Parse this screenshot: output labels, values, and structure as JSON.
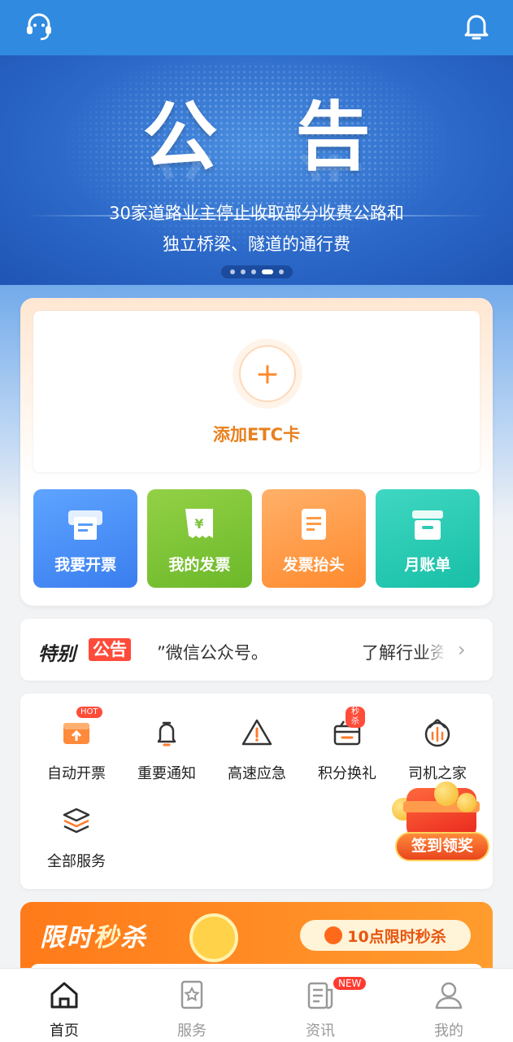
{
  "colors": {
    "brand_blue": "#2f8ae0",
    "accent_orange": "#ff8a2e",
    "tab_active": "#222222"
  },
  "topbar": {
    "left_icon": "headset-icon",
    "right_icon": "bell-icon"
  },
  "banner": {
    "title": "公告",
    "line1": "30家道路业主停止收取部分收费公路和",
    "line2": "独立桥梁、隧道的通行费",
    "pager_count": 5,
    "pager_active": 4
  },
  "etc": {
    "add_label": "添加ETC卡"
  },
  "tiles": [
    {
      "label": "我要开票",
      "icon": "invoice-print-icon"
    },
    {
      "label": "我的发票",
      "icon": "receipt-yen-icon"
    },
    {
      "label": "发票抬头",
      "icon": "document-icon"
    },
    {
      "label": "月账单",
      "icon": "inbox-icon"
    }
  ],
  "notice": {
    "tag_a": "特别",
    "tag_b": "公告",
    "text_a": "”微信公众号。",
    "text_b": "了解行业资",
    "chevron": "›"
  },
  "services": [
    {
      "label": "自动开票",
      "icon": "auto-invoice-icon",
      "badge": "HOT"
    },
    {
      "label": "重要通知",
      "icon": "bell-icon",
      "badge": ""
    },
    {
      "label": "高速应急",
      "icon": "warning-icon",
      "badge": ""
    },
    {
      "label": "积分换礼",
      "icon": "basket-icon",
      "badge": "秒杀"
    },
    {
      "label": "司机之家",
      "icon": "driver-home-icon",
      "badge": ""
    },
    {
      "label": "全部服务",
      "icon": "layers-icon",
      "badge": ""
    }
  ],
  "signin": {
    "label": "签到领奖"
  },
  "flash": {
    "title_a": "限时",
    "title_b": "秒",
    "title_c": "杀",
    "pill": "10点限时秒杀"
  },
  "tabbar": [
    {
      "label": "首页",
      "icon": "home-icon",
      "active": true
    },
    {
      "label": "服务",
      "icon": "bookmark-star-icon",
      "active": false
    },
    {
      "label": "资讯",
      "icon": "news-icon",
      "active": false,
      "badge": "NEW"
    },
    {
      "label": "我的",
      "icon": "user-icon",
      "active": false
    }
  ]
}
